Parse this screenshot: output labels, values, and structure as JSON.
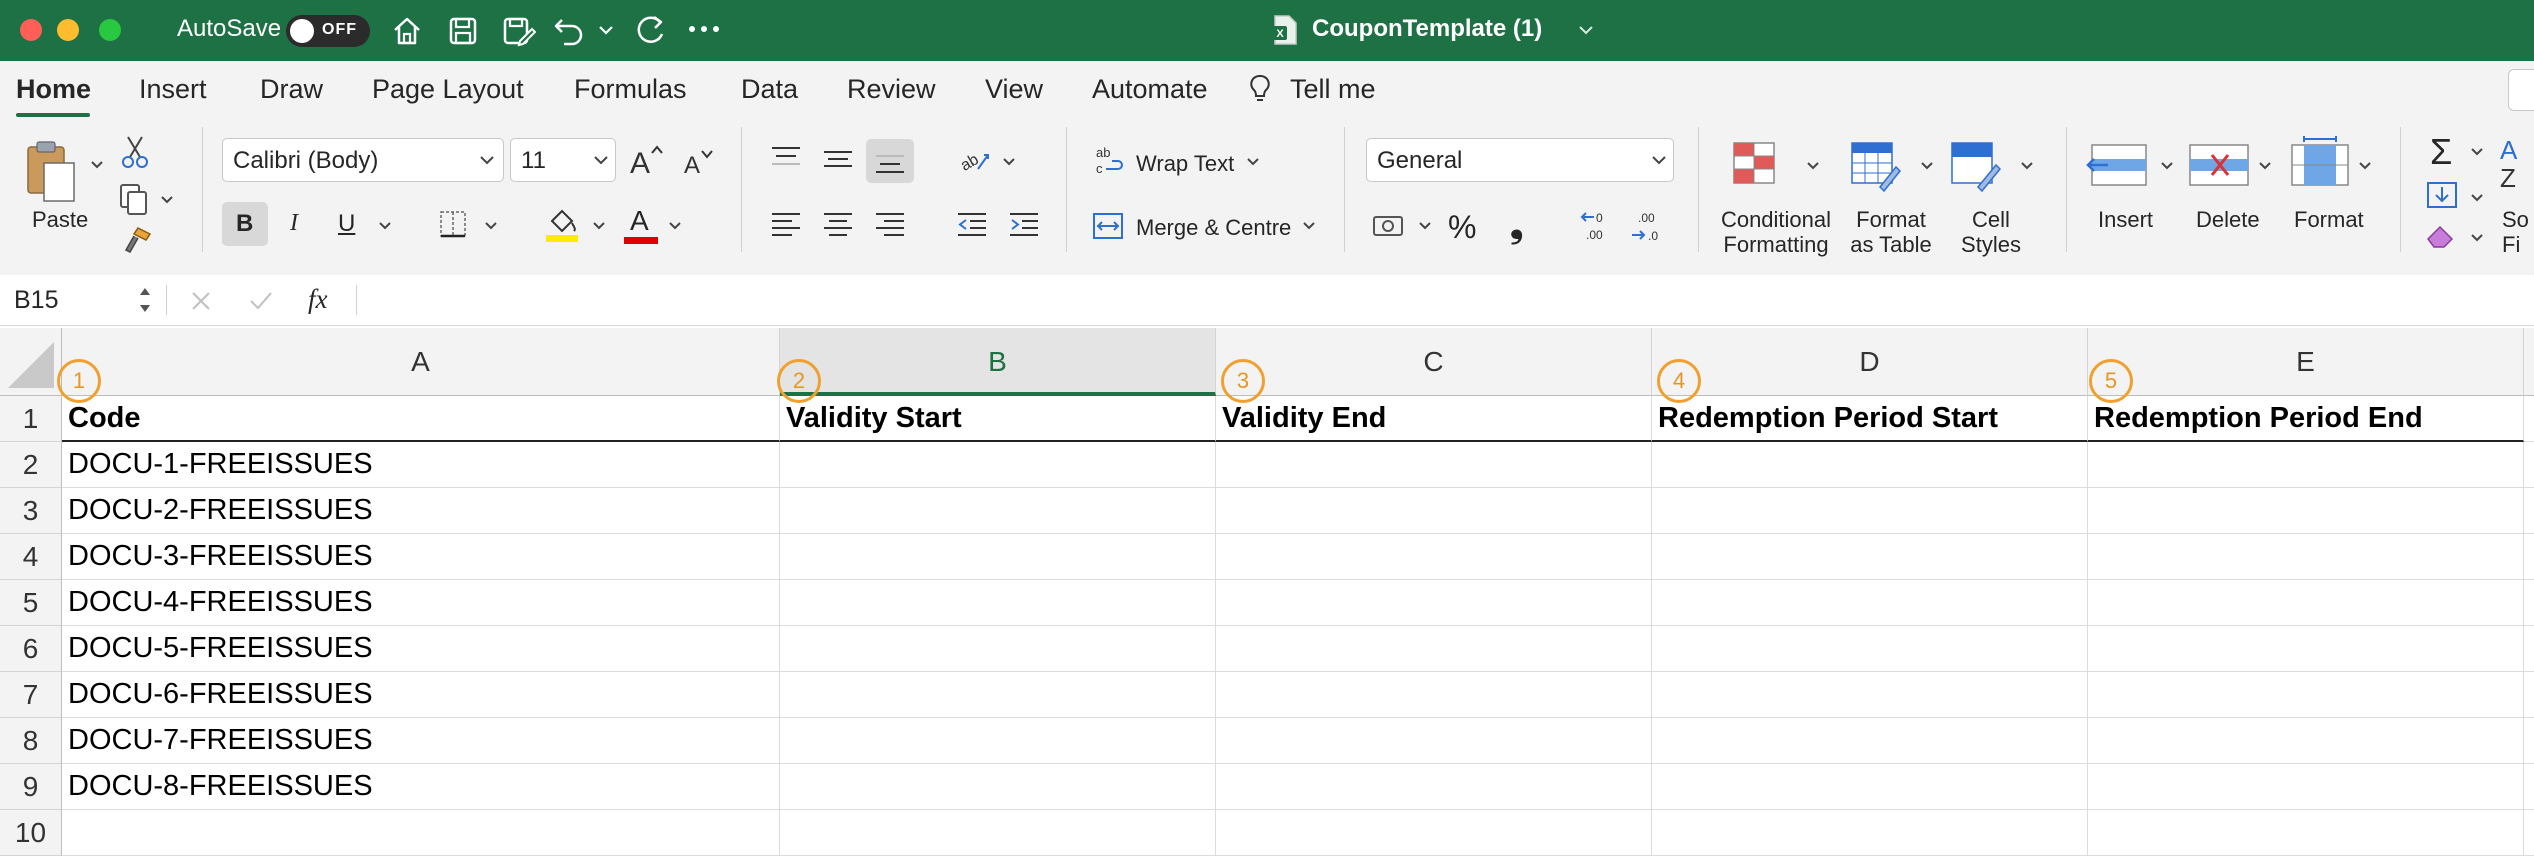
{
  "titlebar": {
    "autosave_label": "AutoSave",
    "autosave_state": "OFF",
    "document_title": "CouponTemplate (1)"
  },
  "ribbon_tabs": [
    "Home",
    "Insert",
    "Draw",
    "Page Layout",
    "Formulas",
    "Data",
    "Review",
    "View",
    "Automate",
    "Tell me"
  ],
  "active_tab": "Home",
  "ribbon": {
    "paste_label": "Paste",
    "font_name": "Calibri (Body)",
    "font_size": "11",
    "bold": "B",
    "italic": "I",
    "underline": "U",
    "font_color_glyph": "A",
    "wrap_text_label": "Wrap Text",
    "merge_label": "Merge & Centre",
    "number_format": "General",
    "percent_glyph": "%",
    "comma_glyph": "❟",
    "conditional_formatting": [
      "Conditional",
      "Formatting"
    ],
    "format_as_table": [
      "Format",
      "as Table"
    ],
    "cell_styles": [
      "Cell",
      "Styles"
    ],
    "insert_label": "Insert",
    "delete_label": "Delete",
    "format_label": "Format",
    "sort_filter_partial": [
      "So",
      "Fi"
    ]
  },
  "formula_bar": {
    "name_box": "B15",
    "fx": "fx",
    "content": ""
  },
  "sheet": {
    "columns": [
      "A",
      "B",
      "C",
      "D",
      "E"
    ],
    "selected_column": "B",
    "badges": [
      "1",
      "2",
      "3",
      "4",
      "5"
    ],
    "row_numbers": [
      "1",
      "2",
      "3",
      "4",
      "5",
      "6",
      "7",
      "8",
      "9",
      "10"
    ],
    "header_row": [
      "Code",
      "Validity Start",
      "Validity End",
      "Redemption Period Start",
      "Redemption Period End"
    ],
    "codes": [
      "DOCU-1-FREEISSUES",
      "DOCU-2-FREEISSUES",
      "DOCU-3-FREEISSUES",
      "DOCU-4-FREEISSUES",
      "DOCU-5-FREEISSUES",
      "DOCU-6-FREEISSUES",
      "DOCU-7-FREEISSUES",
      "DOCU-8-FREEISSUES"
    ]
  },
  "colors": {
    "excel_green": "#1e7145",
    "badge_orange": "#f0a030",
    "highlight_yellow": "#ffeb00",
    "font_red": "#e00000"
  }
}
